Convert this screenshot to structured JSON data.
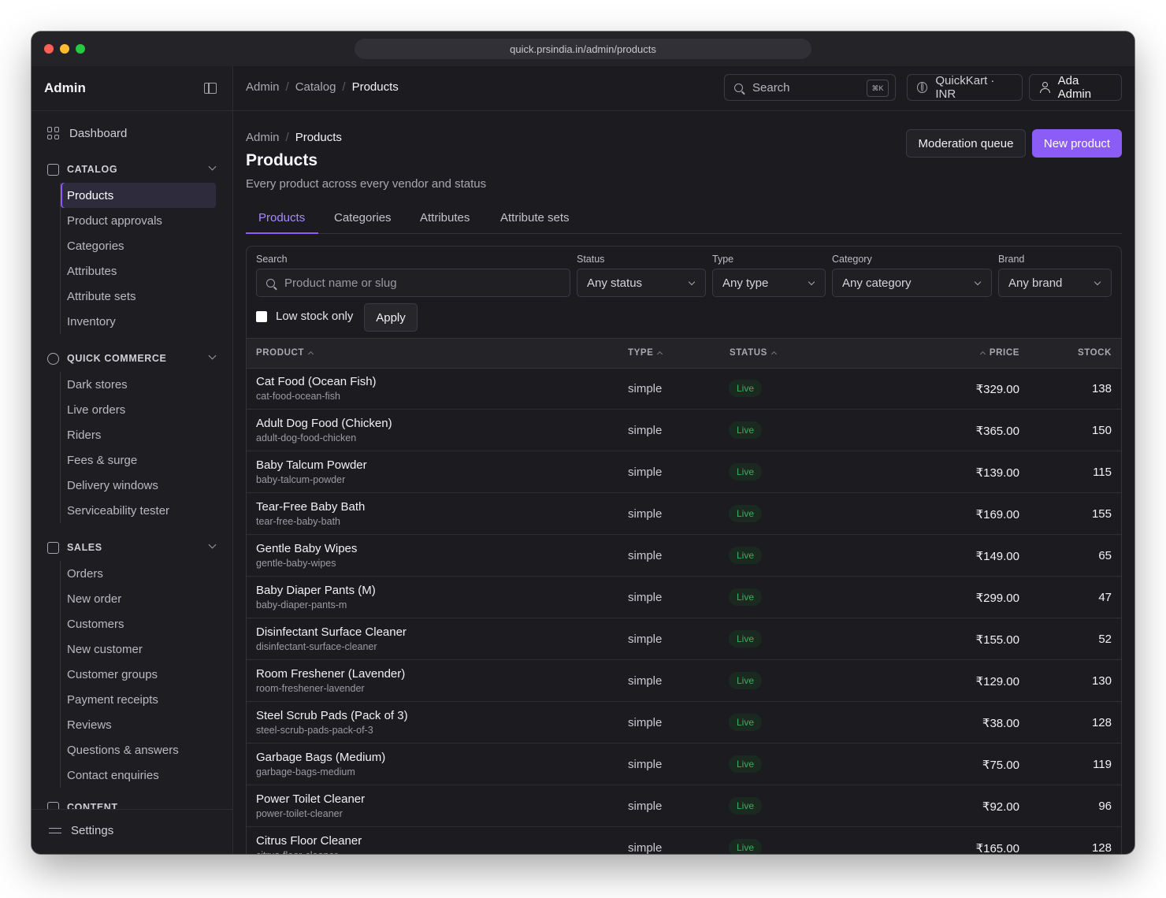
{
  "browser": {
    "url": "quick.prsindia.in/admin/products"
  },
  "sidebar": {
    "title": "Admin",
    "dashboard": "Dashboard",
    "sections": [
      {
        "label": "CATALOG",
        "items": [
          "Products",
          "Product approvals",
          "Categories",
          "Attributes",
          "Attribute sets",
          "Inventory"
        ]
      },
      {
        "label": "QUICK COMMERCE",
        "items": [
          "Dark stores",
          "Live orders",
          "Riders",
          "Fees & surge",
          "Delivery windows",
          "Serviceability tester"
        ]
      },
      {
        "label": "SALES",
        "items": [
          "Orders",
          "New order",
          "Customers",
          "New customer",
          "Customer groups",
          "Payment receipts",
          "Reviews",
          "Questions & answers",
          "Contact enquiries"
        ]
      },
      {
        "label": "CONTENT",
        "items": []
      }
    ],
    "active_item": "Products",
    "settings": "Settings"
  },
  "topbar": {
    "breadcrumb": [
      "Admin",
      "Catalog",
      "Products"
    ],
    "search_label": "Search",
    "search_shortcut": "⌘K",
    "store": "QuickKart · INR",
    "user": "Ada Admin"
  },
  "page": {
    "breadcrumb": [
      "Admin",
      "Products"
    ],
    "title": "Products",
    "subtitle": "Every product across every vendor and status",
    "moderation_button": "Moderation queue",
    "new_button": "New product",
    "tabs": [
      "Products",
      "Categories",
      "Attributes",
      "Attribute sets"
    ],
    "active_tab": "Products"
  },
  "filters": {
    "search_label": "Search",
    "search_placeholder": "Product name or slug",
    "status_label": "Status",
    "status_value": "Any status",
    "type_label": "Type",
    "type_value": "Any type",
    "category_label": "Category",
    "category_value": "Any category",
    "brand_label": "Brand",
    "brand_value": "Any brand",
    "low_stock_label": "Low stock only",
    "low_stock_checked": false,
    "apply_label": "Apply"
  },
  "table": {
    "headers": {
      "product": "PRODUCT",
      "type": "TYPE",
      "status": "STATUS",
      "price": "PRICE",
      "stock": "STOCK"
    },
    "rows": [
      {
        "name": "Cat Food (Ocean Fish)",
        "slug": "cat-food-ocean-fish",
        "type": "simple",
        "status": "Live",
        "price": "₹329.00",
        "stock": "138"
      },
      {
        "name": "Adult Dog Food (Chicken)",
        "slug": "adult-dog-food-chicken",
        "type": "simple",
        "status": "Live",
        "price": "₹365.00",
        "stock": "150"
      },
      {
        "name": "Baby Talcum Powder",
        "slug": "baby-talcum-powder",
        "type": "simple",
        "status": "Live",
        "price": "₹139.00",
        "stock": "115"
      },
      {
        "name": "Tear-Free Baby Bath",
        "slug": "tear-free-baby-bath",
        "type": "simple",
        "status": "Live",
        "price": "₹169.00",
        "stock": "155"
      },
      {
        "name": "Gentle Baby Wipes",
        "slug": "gentle-baby-wipes",
        "type": "simple",
        "status": "Live",
        "price": "₹149.00",
        "stock": "65"
      },
      {
        "name": "Baby Diaper Pants (M)",
        "slug": "baby-diaper-pants-m",
        "type": "simple",
        "status": "Live",
        "price": "₹299.00",
        "stock": "47"
      },
      {
        "name": "Disinfectant Surface Cleaner",
        "slug": "disinfectant-surface-cleaner",
        "type": "simple",
        "status": "Live",
        "price": "₹155.00",
        "stock": "52"
      },
      {
        "name": "Room Freshener (Lavender)",
        "slug": "room-freshener-lavender",
        "type": "simple",
        "status": "Live",
        "price": "₹129.00",
        "stock": "130"
      },
      {
        "name": "Steel Scrub Pads (Pack of 3)",
        "slug": "steel-scrub-pads-pack-of-3",
        "type": "simple",
        "status": "Live",
        "price": "₹38.00",
        "stock": "128"
      },
      {
        "name": "Garbage Bags (Medium)",
        "slug": "garbage-bags-medium",
        "type": "simple",
        "status": "Live",
        "price": "₹75.00",
        "stock": "119"
      },
      {
        "name": "Power Toilet Cleaner",
        "slug": "power-toilet-cleaner",
        "type": "simple",
        "status": "Live",
        "price": "₹92.00",
        "stock": "96"
      },
      {
        "name": "Citrus Floor Cleaner",
        "slug": "citrus-floor-cleaner",
        "type": "simple",
        "status": "Live",
        "price": "₹165.00",
        "stock": "128"
      }
    ]
  },
  "colors": {
    "accent": "#8b5cf6",
    "live_text": "#3fae5a",
    "live_bg": "#1b2a20",
    "background": "#1c1c20"
  }
}
